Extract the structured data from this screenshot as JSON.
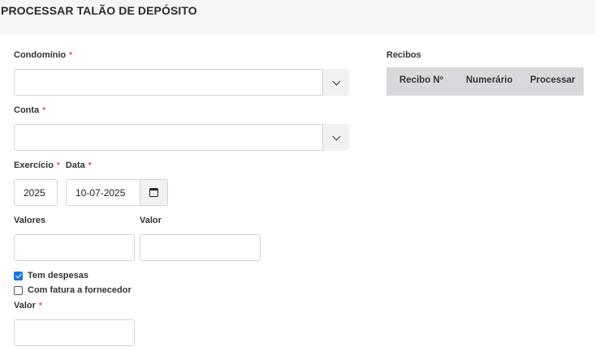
{
  "header": {
    "title": "PROCESSAR TALÃO DE DEPÓSITO"
  },
  "form": {
    "condominio": {
      "label": "Condomínio",
      "required_mark": "*",
      "value": ""
    },
    "conta": {
      "label": "Conta",
      "required_mark": "*",
      "value": ""
    },
    "exercicio": {
      "label": "Exercício",
      "required_mark": "*",
      "value": "2025"
    },
    "data": {
      "label": "Data",
      "required_mark": "*",
      "value": "10-07-2025"
    },
    "valores": {
      "label": "Valores",
      "value": ""
    },
    "valor_top": {
      "label": "Valor",
      "value": ""
    },
    "tem_despesas": {
      "label": "Tem despesas",
      "checked": true
    },
    "com_fatura": {
      "label": "Com fatura a fornecedor",
      "checked": false
    },
    "valor_bottom": {
      "label": "Valor",
      "required_mark": "*",
      "value": ""
    }
  },
  "recibos": {
    "title": "Recibos",
    "columns": [
      "Recibo Nº",
      "Numerário",
      "Processar"
    ]
  },
  "colors": {
    "accent": "#1a73e8",
    "required": "#e5484d"
  }
}
